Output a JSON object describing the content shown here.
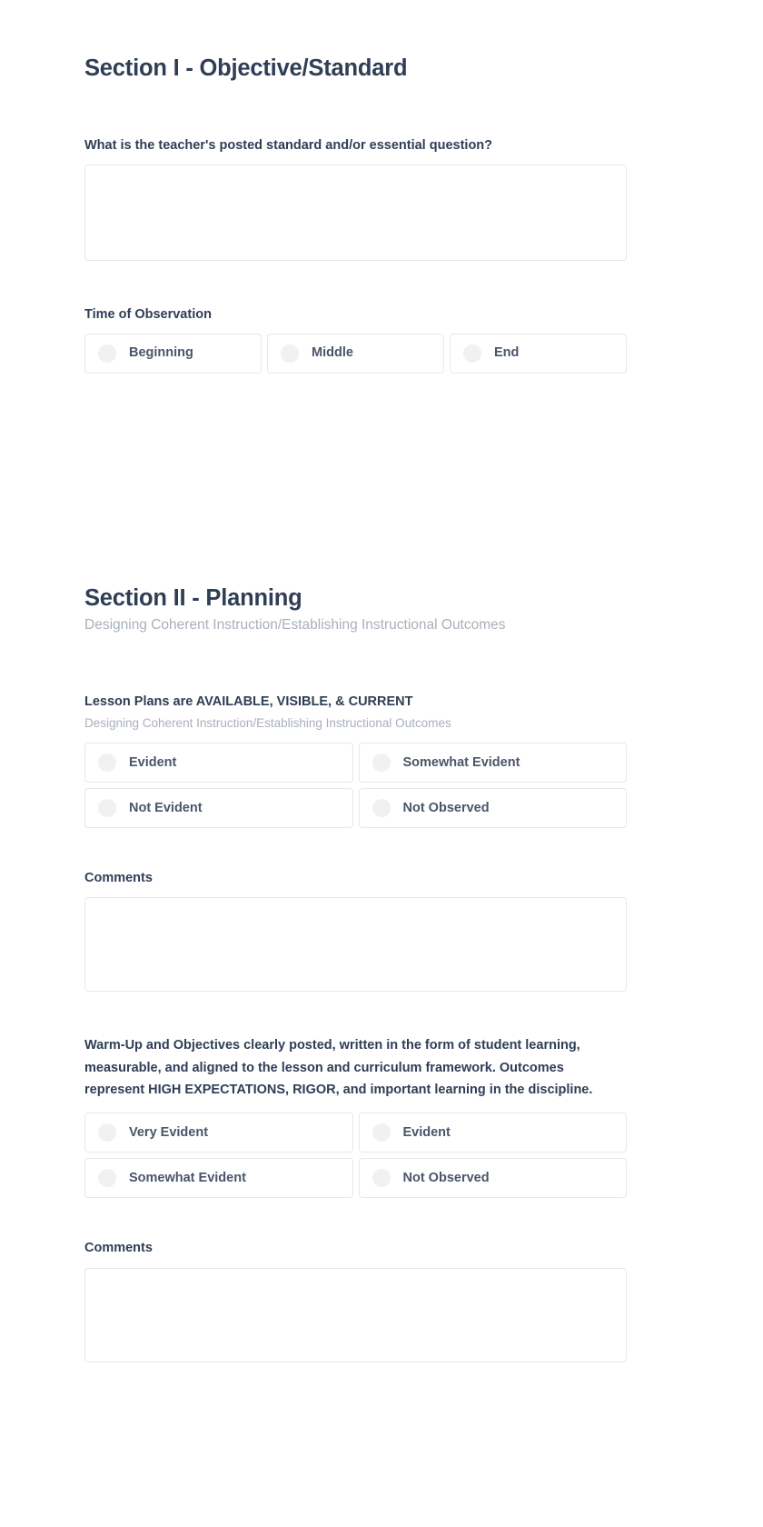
{
  "sections": [
    {
      "title": "Section I - Objective/Standard",
      "subtitle": "",
      "questions": [
        {
          "label": "What is the teacher's posted standard and/or essential question?",
          "help": "",
          "type": "textarea",
          "value": "",
          "placeholder": ""
        },
        {
          "label": "Time of Observation",
          "help": "",
          "type": "radio-row",
          "options": [
            "Beginning",
            "Middle",
            "End"
          ]
        }
      ]
    },
    {
      "title": "Section II - Planning",
      "subtitle": "Designing Coherent Instruction/Establishing Instructional Outcomes",
      "questions": [
        {
          "label": "Lesson Plans are AVAILABLE, VISIBLE, & CURRENT",
          "help": "Designing Coherent Instruction/Establishing Instructional Outcomes",
          "type": "radio-grid",
          "options": [
            "Evident",
            "Somewhat Evident",
            "Not Evident",
            "Not Observed"
          ]
        },
        {
          "label": "Comments",
          "help": "",
          "type": "textarea",
          "value": "",
          "placeholder": ""
        },
        {
          "label": "Warm-Up and Objectives clearly posted, written in the form of student learning, measurable, and aligned to the lesson and curriculum framework. Outcomes represent HIGH EXPECTATIONS, RIGOR, and important learning in the discipline.",
          "help": "",
          "type": "radio-grid",
          "options": [
            "Very Evident",
            "Evident",
            "Somewhat Evident",
            "Not Observed"
          ]
        },
        {
          "label": "Comments",
          "help": "",
          "type": "textarea",
          "value": "",
          "placeholder": ""
        }
      ]
    }
  ],
  "colors": {
    "heading": "#2f3e55",
    "muted": "#a9b0bb",
    "border": "#e5e8ec",
    "radio": "#f1f1f3",
    "background": "#ffffff"
  }
}
